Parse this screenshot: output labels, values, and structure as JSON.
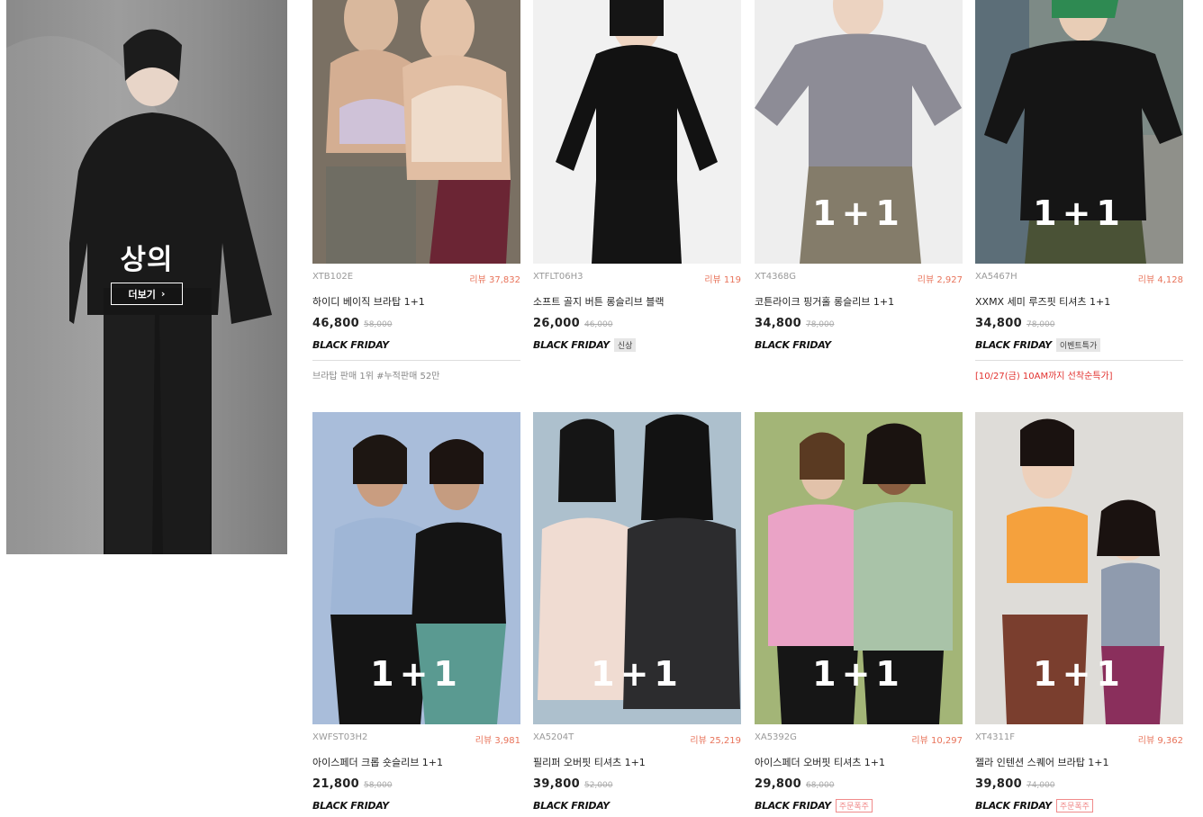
{
  "category": {
    "title": "상의",
    "more_label": "더보기",
    "more_icon": "chevron-right-icon"
  },
  "products": [
    {
      "code": "XTB102E",
      "review": "리뷰 37,832",
      "name": "하이디 베이직 브라탑 1+1",
      "price": "46,800",
      "orig_price": "58,000",
      "event": "BLACK FRIDAY",
      "tag": "",
      "overlay": "",
      "note": "브라탑 판매 1위 #누적판매 52만"
    },
    {
      "code": "XTFLT06H3",
      "review": "리뷰 119",
      "name": "소프트 골지 버튼 롱슬리브 블랙",
      "price": "26,000",
      "orig_price": "46,000",
      "event": "BLACK FRIDAY",
      "tag": "신상",
      "overlay": "",
      "note": ""
    },
    {
      "code": "XT4368G",
      "review": "리뷰 2,927",
      "name": "코튼라이크 핑거홀 롱슬리브 1+1",
      "price": "34,800",
      "orig_price": "78,000",
      "event": "BLACK FRIDAY",
      "tag": "",
      "overlay": "1+1",
      "note": ""
    },
    {
      "code": "XA5467H",
      "review": "리뷰 4,128",
      "name": "XXMX 세미 루즈핏 티셔츠 1+1",
      "price": "34,800",
      "orig_price": "78,000",
      "event": "BLACK FRIDAY",
      "tag": "이벤트특가",
      "overlay": "1+1",
      "note": "[10/27(금) 10AM까지 선착순특가]"
    },
    {
      "code": "XWFST03H2",
      "review": "리뷰 3,981",
      "name": "아이스페더 크롭 숏슬리브 1+1",
      "price": "21,800",
      "orig_price": "58,000",
      "event": "BLACK FRIDAY",
      "tag": "",
      "overlay": "1+1",
      "note": ""
    },
    {
      "code": "XA5204T",
      "review": "리뷰 25,219",
      "name": "필리퍼 오버핏 티셔츠 1+1",
      "price": "39,800",
      "orig_price": "52,000",
      "event": "BLACK FRIDAY",
      "tag": "",
      "overlay": "1+1",
      "note": ""
    },
    {
      "code": "XA5392G",
      "review": "리뷰 10,297",
      "name": "아이스페더 오버핏 티셔츠 1+1",
      "price": "29,800",
      "orig_price": "68,000",
      "event": "BLACK FRIDAY",
      "tag": "주문폭주",
      "overlay": "1+1",
      "note": ""
    },
    {
      "code": "XT4311F",
      "review": "리뷰 9,362",
      "name": "젤라 인텐션 스퀘어 브라탑 1+1",
      "price": "39,800",
      "orig_price": "74,000",
      "event": "BLACK FRIDAY",
      "tag": "주문폭주",
      "overlay": "1+1",
      "note": ""
    }
  ]
}
